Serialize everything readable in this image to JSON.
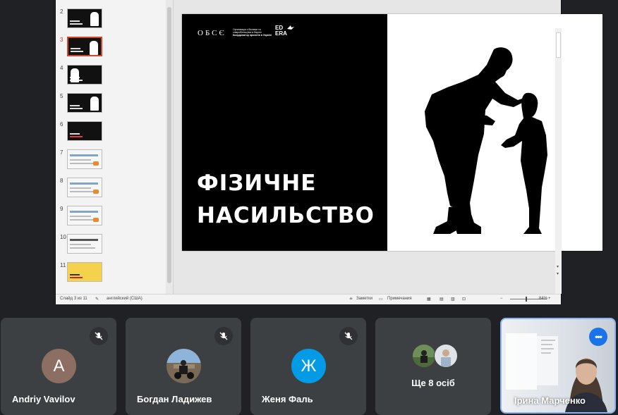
{
  "slide_panel": {
    "thumbnails": [
      {
        "number": "2",
        "style": "dark"
      },
      {
        "number": "3",
        "style": "dark",
        "selected": true
      },
      {
        "number": "4",
        "style": "dark"
      },
      {
        "number": "5",
        "style": "dark"
      },
      {
        "number": "6",
        "style": "dark"
      },
      {
        "number": "7",
        "style": "light"
      },
      {
        "number": "8",
        "style": "light"
      },
      {
        "number": "9",
        "style": "light"
      },
      {
        "number": "10",
        "style": "light"
      },
      {
        "number": "11",
        "style": "yellow"
      }
    ]
  },
  "slide": {
    "osce_logo": "ОБСЄ",
    "osce_text_line1": "Організація з безпеки та",
    "osce_text_line2": "співробітництва в Європі",
    "osce_text_line3": "Координатор проектів в Україні",
    "edera_logo": "ED ERA",
    "title_line1": "ФІЗИЧНЕ",
    "title_line2": "НАСИЛЬСТВО",
    "background_left": "#000000",
    "background_right": "#ffffff"
  },
  "status_bar": {
    "slide_info": "Слайд 3 из 11",
    "language": "английский (США)",
    "notes": "Заметки",
    "comments": "Примечания",
    "zoom": "84%"
  },
  "participants": [
    {
      "name": "Andriy Vavilov",
      "initial": "A",
      "avatar_color": "#8d6e63",
      "muted": true
    },
    {
      "name": "Богдан Ладижев",
      "avatar": "photo-avatar",
      "muted": true
    },
    {
      "name": "Женя Фаль",
      "initial": "Ж",
      "avatar_color": "#039be5",
      "muted": true
    },
    {
      "name": "Ще 8 осіб",
      "avatar": "group-avatars"
    },
    {
      "name": "Ірина Марченко",
      "video": "camera-feed",
      "active_speaker": true
    }
  ],
  "colors": {
    "page_background": "#202124",
    "tile_background": "#3c4043",
    "active_border": "#8ab4f8",
    "accent_blue": "#1a73e8"
  }
}
